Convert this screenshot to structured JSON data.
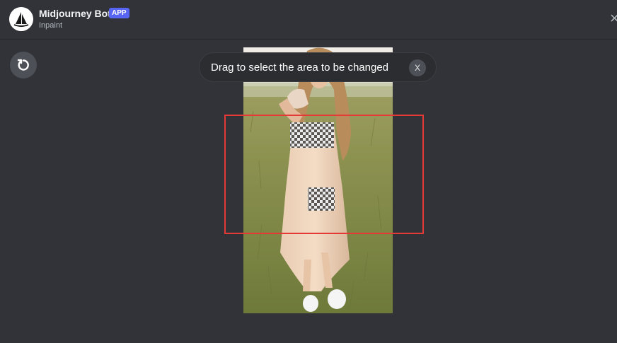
{
  "header": {
    "bot_name": "Midjourney Bot",
    "badge": "APP",
    "subtitle": "Inpaint",
    "close_glyph": "×",
    "avatar_icon": "sailboat-logo-icon"
  },
  "toolbar": {
    "reset_icon": "undo-icon"
  },
  "tooltip": {
    "text": "Drag to select the area to be changed",
    "close_label": "X"
  },
  "image": {
    "description_icon": "image-canvas"
  },
  "colors": {
    "background": "#313338",
    "badge": "#5865f2",
    "selection": "#e53935"
  }
}
